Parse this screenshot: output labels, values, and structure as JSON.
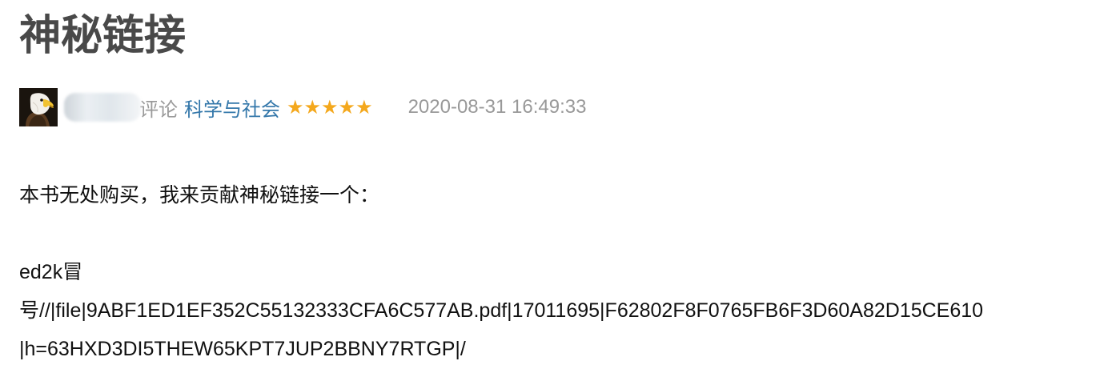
{
  "review": {
    "title": "神秘链接",
    "meta": {
      "review_word": "评论",
      "book_title": "科学与社会",
      "stars": "★★★★★",
      "rating_stars": 5,
      "timestamp": "2020-08-31 16:49:33"
    },
    "body": {
      "intro": "本书无处购买，我来贡献神秘链接一个：",
      "link_lines": [
        " ed2k冒",
        "号//|file|9ABF1ED1EF352C55132333CFA6C577AB.pdf|17011695|F62802F8F0765FB6F3D60A82D15CE610",
        "|h=63HXD3DI5THEW65KPT7JUP2BBNY7RTGP|/"
      ]
    }
  },
  "colors": {
    "title": "#494949",
    "link": "#3377aa",
    "muted": "#999999",
    "star": "#f4a81d"
  }
}
